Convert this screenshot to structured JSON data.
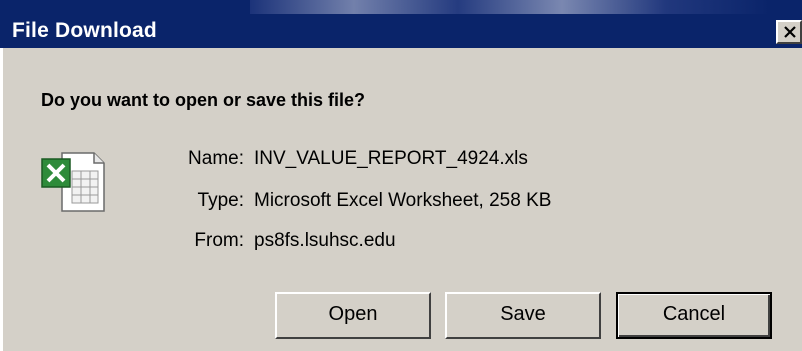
{
  "window": {
    "title": "File Download",
    "colors": {
      "titlebar": "#0a246a",
      "face": "#d4d0c8"
    }
  },
  "dialog": {
    "question": "Do you want to open or save this file?",
    "file_icon": "excel-file-icon",
    "rows": [
      {
        "label": "Name:",
        "value": "INV_VALUE_REPORT_4924.xls"
      },
      {
        "label": "Type:",
        "value": "Microsoft Excel Worksheet, 258 KB"
      },
      {
        "label": "From:",
        "value": "ps8fs.lsuhsc.edu"
      }
    ]
  },
  "buttons": {
    "open": "Open",
    "save": "Save",
    "cancel": "Cancel"
  }
}
